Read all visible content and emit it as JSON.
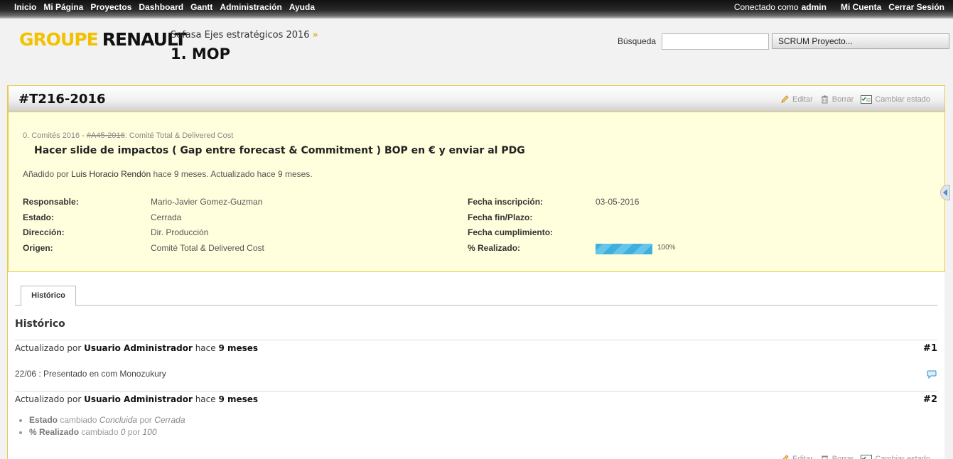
{
  "top_menu": {
    "items": [
      "Inicio",
      "Mi Página",
      "Proyectos",
      "Dashboard",
      "Gantt",
      "Administración",
      "Ayuda"
    ],
    "logged_in_label": "Conectado como",
    "logged_in_user": "admin",
    "my_account": "Mi Cuenta",
    "logout": "Cerrar Sesión"
  },
  "header": {
    "logo_part1": "GROUPE",
    "logo_part2": "RENAULT",
    "breadcrumb_parent": "Sofasa Ejes estratégicos 2016",
    "breadcrumb_sep": "»",
    "project_title": "1. MOP",
    "search_label": "Búsqueda",
    "search_value": "",
    "project_jump": "SCRUM Proyecto..."
  },
  "issue": {
    "id": "#T216-2016",
    "actions": {
      "edit": "Editar",
      "delete": "Borrar",
      "change_status": "Cambiar estado"
    },
    "parent_prefix": "0. Comités 2016 -",
    "parent_id": "#A45-2016",
    "parent_subject": ": Comité Total & Delivered Cost",
    "subject": "Hacer slide de impactos ( Gap entre forecast & Commitment ) BOP en € y enviar al PDG",
    "author_prefix": "Añadido por",
    "author": "Luis Horacio Rendón",
    "added_ago": "hace 9 meses",
    "updated_text": ". Actualizado",
    "updated_ago": "hace 9 meses",
    "fields_left": [
      {
        "label": "Responsable:",
        "value": "Mario-Javier Gomez-Guzman"
      },
      {
        "label": "Estado:",
        "value": "Cerrada"
      },
      {
        "label": "Dirección:",
        "value": "Dir. Producción"
      },
      {
        "label": "Origen:",
        "value": "Comité Total & Delivered Cost"
      }
    ],
    "fields_right": [
      {
        "label": "Fecha inscripción:",
        "value": "03-05-2016"
      },
      {
        "label": "Fecha fin/Plazo:",
        "value": ""
      },
      {
        "label": "Fecha cumplimiento:",
        "value": ""
      },
      {
        "label": "% Realizado:",
        "value": ""
      }
    ],
    "done_ratio": 100,
    "done_ratio_label": "100%"
  },
  "tabs": {
    "history": "Histórico"
  },
  "history": {
    "title": "Histórico",
    "journals": [
      {
        "updated_by": "Actualizado por",
        "user": "Usuario Administrador",
        "ago_prefix": "hace",
        "ago": "9 meses",
        "number": "#1",
        "note": "22/06 : Presentado en com Monozukury"
      },
      {
        "updated_by": "Actualizado por",
        "user": "Usuario Administrador",
        "ago_prefix": "hace",
        "ago": "9 meses",
        "number": "#2",
        "details": [
          {
            "field": "Estado",
            "changed": "cambiado",
            "from": "Concluida",
            "by": "por",
            "to": "Cerrada"
          },
          {
            "field": "% Realizado",
            "changed": "cambiado",
            "from": "0",
            "by": "por",
            "to": "100"
          }
        ]
      }
    ]
  },
  "colors": {
    "accent_yellow": "#f2c200",
    "issue_bg": "#ffffdd",
    "progress": "#3fb0dd"
  },
  "icons": [
    "edit-icon",
    "delete-icon",
    "change-status-icon",
    "quote-icon",
    "sidebar-toggle-icon"
  ]
}
